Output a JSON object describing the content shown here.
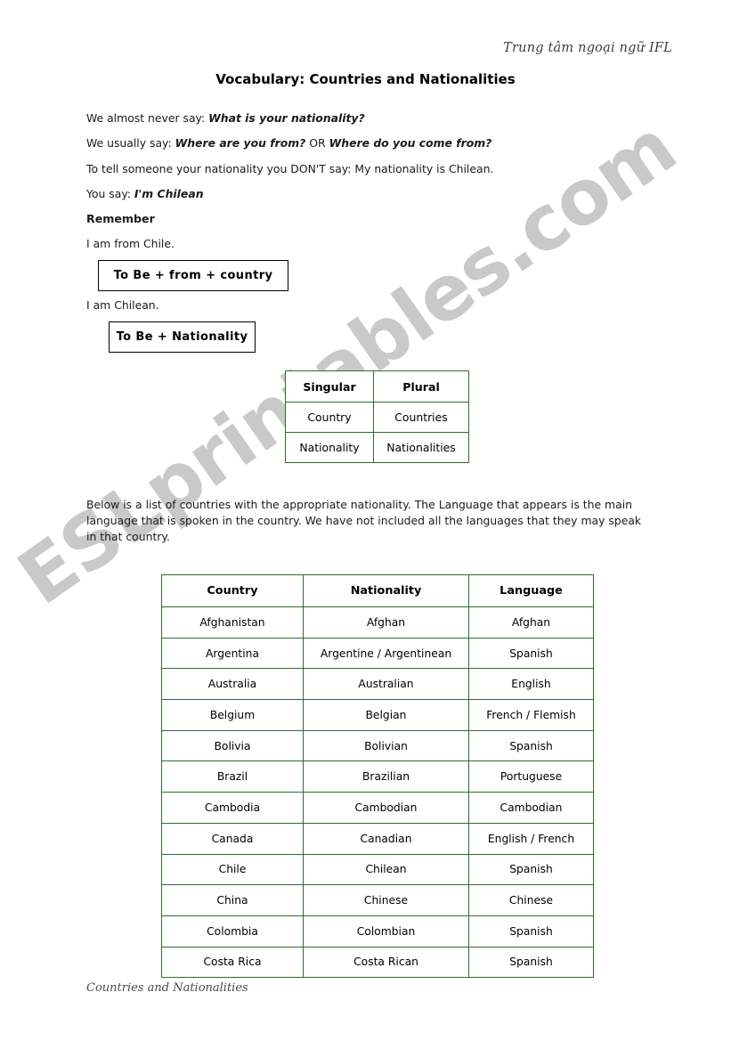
{
  "header": {
    "org_line": "Trung tâm ngoại ngữ IFL",
    "title": "Vocabulary: Countries and Nationalities"
  },
  "intro": {
    "line1_prefix": "We almost never say: ",
    "line1_emphasis": "What is your nationality?",
    "line2_prefix": "We usually say: ",
    "line2_emphasis_a": "Where are you from?",
    "line2_middle": " OR ",
    "line2_emphasis_b": "Where do you come from?",
    "line3": "To tell someone your nationality you DON'T say: My nationality is Chilean.",
    "line4_prefix": "You say: ",
    "line4_emphasis": "I'm Chilean",
    "remember_heading": "Remember",
    "example1": "I am from Chile.",
    "formula1": "To Be + from + country",
    "example2": "I am Chilean.",
    "formula2": "To Be + Nationality"
  },
  "singular_plural_table": {
    "headers": [
      "Singular",
      "Plural"
    ],
    "rows": [
      [
        "Country",
        "Countries"
      ],
      [
        "Nationality",
        "Nationalities"
      ]
    ]
  },
  "description": "Below is a list of countries with the appropriate nationality. The Language that appears is the main language that is spoken in the country. We have not included all the languages that they may speak in that country.",
  "main_table": {
    "headers": [
      "Country",
      "Nationality",
      "Language"
    ],
    "rows": [
      [
        "Afghanistan",
        "Afghan",
        "Afghan"
      ],
      [
        "Argentina",
        "Argentine / Argentinean",
        "Spanish"
      ],
      [
        "Australia",
        "Australian",
        "English"
      ],
      [
        "Belgium",
        "Belgian",
        "French / Flemish"
      ],
      [
        "Bolivia",
        "Bolivian",
        "Spanish"
      ],
      [
        "Brazil",
        "Brazilian",
        "Portuguese"
      ],
      [
        "Cambodia",
        "Cambodian",
        "Cambodian"
      ],
      [
        "Canada",
        "Canadian",
        "English / French"
      ],
      [
        "Chile",
        "Chilean",
        "Spanish"
      ],
      [
        "China",
        "Chinese",
        "Chinese"
      ],
      [
        "Colombia",
        "Colombian",
        "Spanish"
      ],
      [
        "Costa Rica",
        "Costa Rican",
        "Spanish"
      ]
    ]
  },
  "footer": {
    "label": "Countries and Nationalities"
  },
  "watermark": {
    "text": "ESLprintables.com",
    "color": "#c9c9c9"
  },
  "colors": {
    "table_border_green": "#2e6b34",
    "box_border_black": "#000000",
    "text": "#000000"
  }
}
